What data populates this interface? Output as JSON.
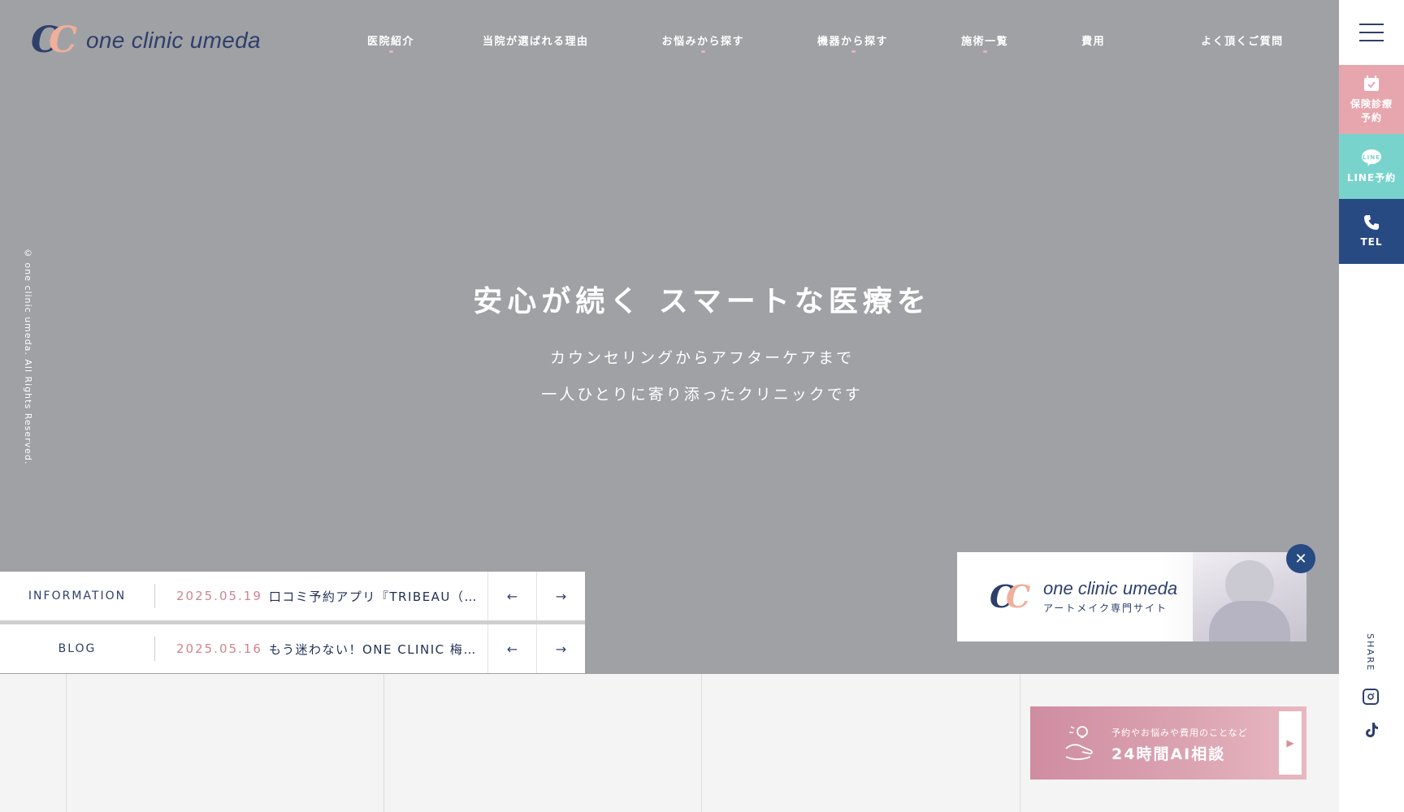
{
  "header": {
    "logo_text": "one clinic umeda",
    "nav": [
      "医院紹介",
      "当院が選ばれる理由",
      "お悩みから探す",
      "機器から探す",
      "施術一覧",
      "費用",
      "よく頂くご質問"
    ]
  },
  "copyright": "© one clinic umeda. All Rights Reserved.",
  "hero": {
    "title": "安心が続く スマートな医療を",
    "sub1": "カウンセリングからアフターケアまで",
    "sub2": "一人ひとりに寄り添ったクリニックです"
  },
  "news": {
    "info": {
      "label": "INFORMATION",
      "date": "2025.05.19",
      "title": "口コミ予約アプリ『TRIBEAU（…"
    },
    "blog": {
      "label": "BLOG",
      "date": "2025.05.16",
      "title": "もう迷わない！ONE CLINIC 梅…"
    },
    "prev_icon": "←",
    "next_icon": "→"
  },
  "sidebar": {
    "insurance_label": "保険診療予約",
    "insurance_line1": "保険診療",
    "insurance_line2": "予約",
    "line_label": "LINE予約",
    "tel_label": "TEL",
    "share_label": "SHARE"
  },
  "artmake": {
    "name": "one clinic umeda",
    "sub": "アートメイク専門サイト",
    "close": "✕"
  },
  "ai": {
    "small": "予約やお悩みや費用のことなど",
    "big": "24時間AI相談",
    "play": "▶"
  },
  "colors": {
    "navy": "#2e3f6a",
    "peach": "#efaf9b",
    "hero_gray": "#a0a1a5",
    "insurance_pink": "#e7a6ae",
    "line_teal": "#78d3cc",
    "tel_blue": "#284a83",
    "date_pink": "#d08590"
  },
  "icons": {
    "menu": "hamburger-menu-icon",
    "insurance": "calendar-check-icon",
    "line": "line-chat-icon",
    "tel": "phone-icon",
    "instagram": "instagram-icon",
    "tiktok": "tiktok-icon",
    "ai": "hand-lightbulb-icon"
  }
}
